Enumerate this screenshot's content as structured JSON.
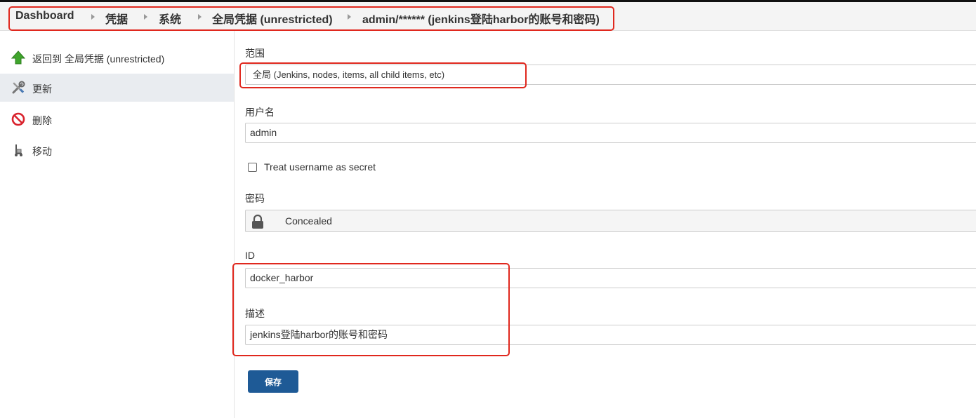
{
  "breadcrumb": {
    "items": [
      "Dashboard",
      "凭据",
      "系统",
      "全局凭据 (unrestricted)",
      "admin/****** (jenkins登陆harbor的账号和密码)"
    ]
  },
  "sidebar": {
    "items": [
      {
        "label": "返回到 全局凭据 (unrestricted)",
        "icon": "up-arrow-icon"
      },
      {
        "label": "更新",
        "icon": "tools-icon"
      },
      {
        "label": "删除",
        "icon": "no-entry-icon"
      },
      {
        "label": "移动",
        "icon": "move-icon"
      }
    ]
  },
  "form": {
    "scope_label": "范围",
    "scope_value": "全局 (Jenkins, nodes, items, all child items, etc)",
    "username_label": "用户名",
    "username_value": "admin",
    "treat_secret_label": "Treat username as secret",
    "password_label": "密码",
    "password_value": "Concealed",
    "id_label": "ID",
    "id_value": "docker_harbor",
    "description_label": "描述",
    "description_value": "jenkins登陆harbor的账号和密码",
    "save_label": "保存"
  },
  "colors": {
    "highlight": "#e0281e",
    "primary_button": "#1e5a96",
    "active_sidebar": "#e9ecf0"
  }
}
